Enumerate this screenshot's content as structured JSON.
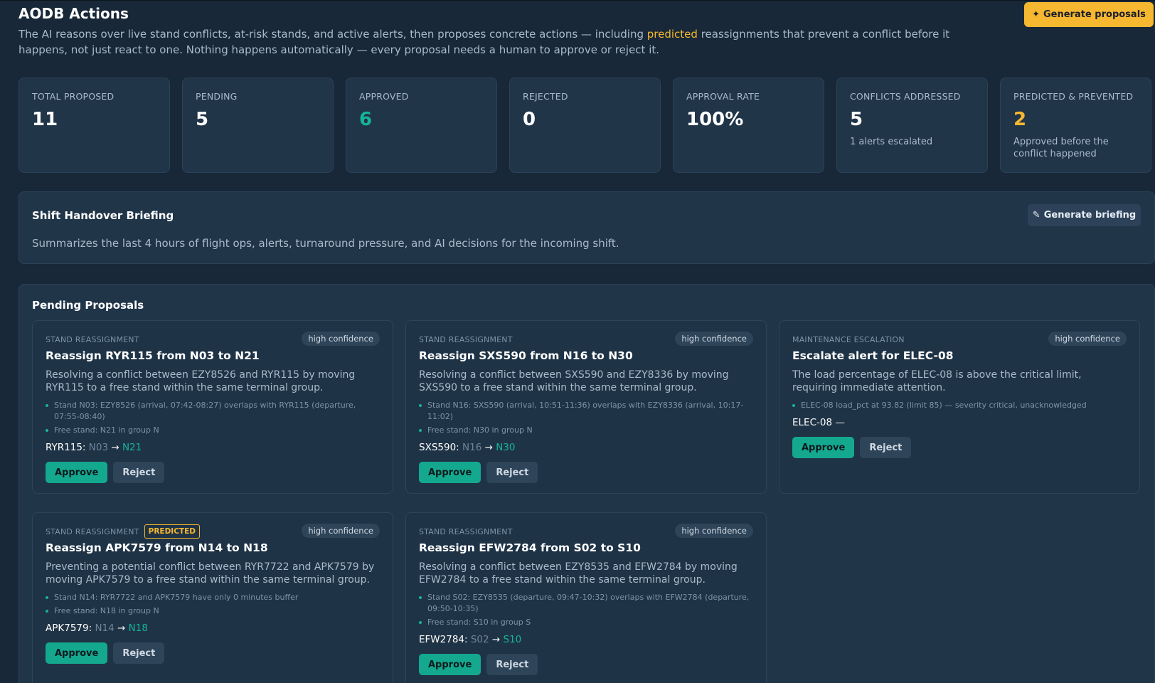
{
  "header": {
    "title": "AODB Actions",
    "subtitle_before": "The AI reasons over live stand conflicts, at-risk stands, and active alerts, then proposes concrete actions — including ",
    "subtitle_highlight": "predicted",
    "subtitle_after": " reassignments that prevent a conflict before it happens, not just react to one. Nothing happens automatically — every proposal needs a human to approve or reject it.",
    "generate_label": "Generate proposals",
    "generate_icon": "✦"
  },
  "stats": [
    {
      "label": "TOTAL PROPOSED",
      "value": "11",
      "sub": ""
    },
    {
      "label": "PENDING",
      "value": "5",
      "sub": ""
    },
    {
      "label": "APPROVED",
      "value": "6",
      "sub": ""
    },
    {
      "label": "REJECTED",
      "value": "0",
      "sub": ""
    },
    {
      "label": "APPROVAL RATE",
      "value": "100%",
      "sub": ""
    },
    {
      "label": "CONFLICTS ADDRESSED",
      "value": "5",
      "sub": "1 alerts escalated"
    },
    {
      "label": "PREDICTED & PREVENTED",
      "value": "2",
      "sub": "Approved before the conflict happened"
    }
  ],
  "colors": {
    "accent_green": "#16b39a",
    "accent_yellow": "#f6b731",
    "background": "#182838",
    "panel": "#213549"
  },
  "briefing": {
    "title": "Shift Handover Briefing",
    "text": "Summarizes the last 4 hours of flight ops, alerts, turnaround pressure, and AI decisions for the incoming shift.",
    "button_label": "Generate briefing",
    "button_icon": "✎"
  },
  "pending": {
    "title": "Pending Proposals",
    "approve_label": "Approve",
    "reject_label": "Reject",
    "cards": [
      {
        "type": "STAND REASSIGNMENT",
        "predicted": "",
        "confidence": "high confidence",
        "title": "Reassign RYR115 from N03 to N21",
        "desc": "Resolving a conflict between EZY8526 and RYR115 by moving RYR115 to a free stand within the same terminal group.",
        "evidence": [
          "Stand N03: EZY8526 (arrival, 07:42-08:27) overlaps with RYR115 (departure, 07:55-08:40)",
          "Free stand: N21 in group N"
        ],
        "flight": "RYR115:",
        "from": "N03",
        "arrow": "→",
        "to": "N21"
      },
      {
        "type": "STAND REASSIGNMENT",
        "predicted": "",
        "confidence": "high confidence",
        "title": "Reassign SXS590 from N16 to N30",
        "desc": "Resolving a conflict between SXS590 and EZY8336 by moving SXS590 to a free stand within the same terminal group.",
        "evidence": [
          "Stand N16: SXS590 (arrival, 10:51-11:36) overlaps with EZY8336 (arrival, 10:17-11:02)",
          "Free stand: N30 in group N"
        ],
        "flight": "SXS590:",
        "from": "N16",
        "arrow": "→",
        "to": "N30"
      },
      {
        "type": "MAINTENANCE ESCALATION",
        "predicted": "",
        "confidence": "high confidence",
        "title": "Escalate alert for ELEC-08",
        "desc": "The load percentage of ELEC-08 is above the critical limit, requiring immediate attention.",
        "evidence": [
          "ELEC-08 load_pct at 93.82 (limit 85) — severity critical, unacknowledged"
        ],
        "flight": "ELEC-08 —",
        "from": "",
        "arrow": "",
        "to": ""
      },
      {
        "type": "STAND REASSIGNMENT",
        "predicted": "PREDICTED",
        "confidence": "high confidence",
        "title": "Reassign APK7579 from N14 to N18",
        "desc": "Preventing a potential conflict between RYR7722 and APK7579 by moving APK7579 to a free stand within the same terminal group.",
        "evidence": [
          "Stand N14: RYR7722 and APK7579 have only 0 minutes buffer",
          "Free stand: N18 in group N"
        ],
        "flight": "APK7579:",
        "from": "N14",
        "arrow": "→",
        "to": "N18"
      },
      {
        "type": "STAND REASSIGNMENT",
        "predicted": "",
        "confidence": "high confidence",
        "title": "Reassign EFW2784 from S02 to S10",
        "desc": "Resolving a conflict between EZY8535 and EFW2784 by moving EFW2784 to a free stand within the same terminal group.",
        "evidence": [
          "Stand S02: EZY8535 (departure, 09:47-10:32) overlaps with EFW2784 (departure, 09:50-10:35)",
          "Free stand: S10 in group S"
        ],
        "flight": "EFW2784:",
        "from": "S02",
        "arrow": "→",
        "to": "S10"
      }
    ]
  }
}
